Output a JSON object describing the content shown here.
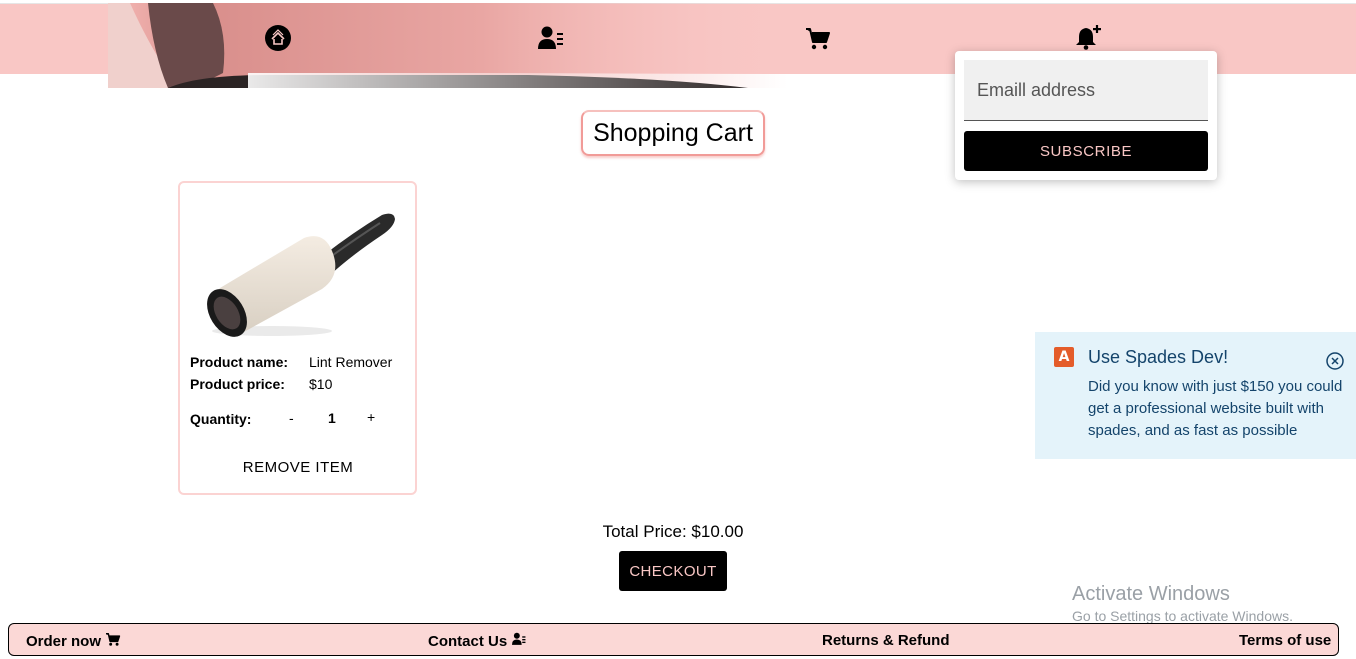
{
  "nav": {
    "icons": [
      "home-logo-icon",
      "user-list-icon",
      "cart-icon",
      "bell-plus-icon"
    ]
  },
  "subscribe": {
    "placeholder": "Emaill address",
    "button": "SUBSCRIBE"
  },
  "page_title": "Shopping Cart",
  "cart": {
    "items": [
      {
        "name_label": "Product name:",
        "name": "Lint Remover",
        "price_label": "Product price:",
        "price": "$10",
        "quantity_label": "Quantity:",
        "decrement": "-",
        "quantity": "1",
        "increment": "+",
        "remove": "REMOVE ITEM"
      }
    ],
    "total": "Total Price: $10.00",
    "checkout": "CHECKOUT"
  },
  "toast": {
    "logo_letter": "A",
    "title": "Use Spades Dev!",
    "body": "Did you know with just $150 you could get a professional website built with spades, and as fast as possible"
  },
  "watermark": {
    "line1": "Activate Windows",
    "line2": "Go to Settings to activate Windows."
  },
  "footer": {
    "order": "Order now",
    "contact": "Contact Us",
    "returns": "Returns & Refund",
    "terms": "Terms of use"
  },
  "colors": {
    "nav_bg": "#f9c7c5",
    "footer_bg": "#fbd8d6",
    "button_bg": "#000000",
    "button_text": "#f9c7c5",
    "toast_bg": "#e4f3fa",
    "toast_text": "#14446b"
  }
}
